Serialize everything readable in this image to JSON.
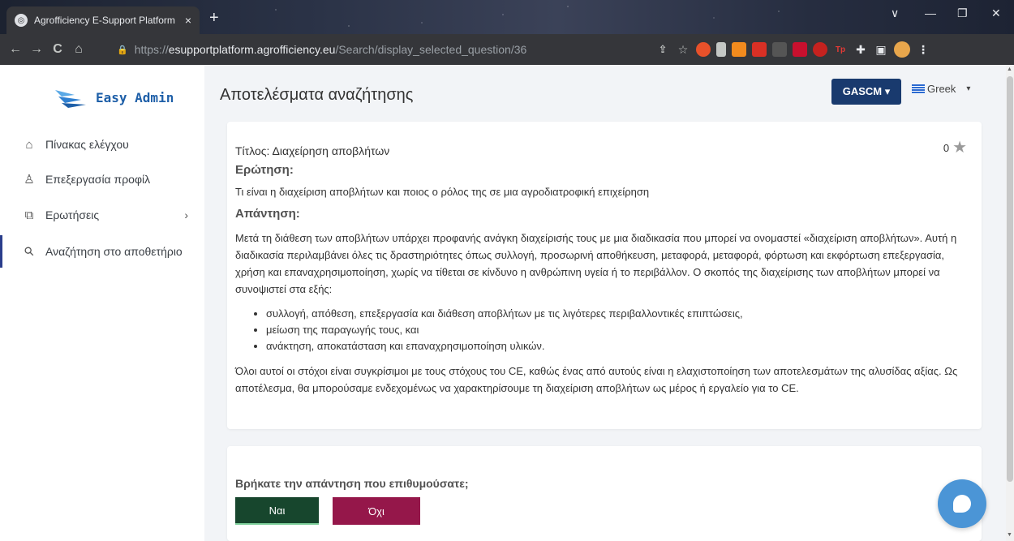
{
  "browser": {
    "tab_title": "Agrofficiency E-Support Platform",
    "tab_close": "×",
    "new_tab": "+",
    "url_scheme": "https://",
    "url_host": "esupportplatform.agrofficiency.eu",
    "url_path": "/Search/display_selected_question/36",
    "nav": {
      "back": "←",
      "forward": "→",
      "reload": "C",
      "home": "⌂"
    },
    "window_controls": {
      "collapse": "∨",
      "minimize": "—",
      "restore": "❐",
      "close": "✕"
    }
  },
  "sidebar": {
    "brand": "Easy Admin",
    "items": [
      {
        "label": "Πίνακας ελέγχου",
        "icon": "home-icon",
        "glyph": "⌂"
      },
      {
        "label": "Επεξεργασία προφίλ",
        "icon": "user-icon",
        "glyph": "♙"
      },
      {
        "label": "Ερωτήσεις",
        "icon": "questions-icon",
        "glyph": "⧉",
        "chevron": "›"
      },
      {
        "label": "Αναζήτηση στο αποθετήριο",
        "icon": "search-icon",
        "glyph": "⚲"
      }
    ]
  },
  "header": {
    "page_title": "Αποτελέσματα αναζήτησης",
    "org_button": "GASCM ▾",
    "language": "Greek",
    "language_caret": "▾"
  },
  "result": {
    "title": "Τίτλος: Διαχείρηση αποβλήτων",
    "rating": "0",
    "question_heading": "Ερώτηση:",
    "question_text": "Τι είναι η διαχείριση αποβλήτων και ποιος ο ρόλος της σε μια αγροδιατροφική επιχείρηση",
    "answer_heading": "Απάντηση:",
    "answer_intro": "Μετά τη διάθεση των αποβλήτων υπάρχει προφανής ανάγκη διαχείρισής τους με μια διαδικασία που μπορεί να ονομαστεί «διαχείριση αποβλήτων». Αυτή η διαδικασία περιλαμβάνει όλες τις δραστηριότητες όπως συλλογή, προσωρινή αποθήκευση, μεταφορά, μεταφορά, φόρτωση και εκφόρτωση επεξεργασία, χρήση και επαναχρησιμοποίηση, χωρίς να τίθεται σε κίνδυνο η ανθρώπινη υγεία ή το περιβάλλον. Ο σκοπός της διαχείρισης των αποβλήτων μπορεί να συνοψιστεί στα εξής:",
    "answer_bullets": [
      "συλλογή, απόθεση, επεξεργασία και διάθεση αποβλήτων με τις λιγότερες περιβαλλοντικές επιπτώσεις,",
      "μείωση της παραγωγής τους, και",
      "ανάκτηση, αποκατάσταση και επαναχρησιμοποίηση υλικών."
    ],
    "answer_outro": "Όλοι αυτοί οι στόχοι είναι συγκρίσιμοι με τους στόχους του CE, καθώς ένας από αυτούς είναι η ελαχιστοποίηση των αποτελεσμάτων της αλυσίδας αξίας. Ως αποτέλεσμα, θα μπορούσαμε ενδεχομένως να χαρακτηρίσουμε τη διαχείριση αποβλήτων ως μέρος ή εργαλείο για το CE."
  },
  "feedback": {
    "question": "Βρήκατε την απάντηση που επιθυμούσατε;",
    "yes": "Ναι",
    "no": "Όχι"
  },
  "colors": {
    "brand": "#1e5fa8",
    "primary_button": "#193a6e",
    "yes_button": "#17462d",
    "no_button": "#95174a",
    "chat": "#4b95d6"
  }
}
